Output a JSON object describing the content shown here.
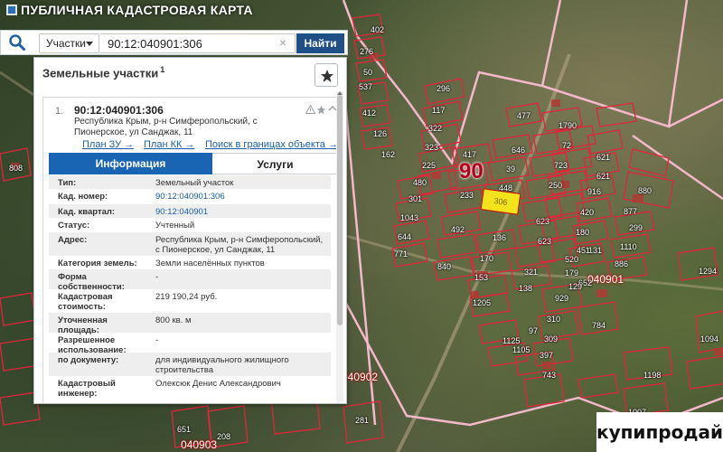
{
  "app": {
    "title": "ПУБЛИЧНАЯ КАДАСТРОВАЯ КАРТА"
  },
  "search": {
    "type_selected": "Участки",
    "value": "90:12:040901:306",
    "clear_symbol": "×",
    "button_label": "Найти"
  },
  "panel": {
    "title": "Земельные участки",
    "title_sup": "1",
    "result": {
      "index": "1.",
      "number": "90:12:040901:306",
      "address": "Республика Крым, р-н Симферопольский, с Пионерское, ул Санджак, 11"
    },
    "links": [
      "План ЗУ →",
      "План КК →",
      "Поиск в границах объекта →"
    ],
    "tabs": [
      "Информация",
      "Услуги"
    ],
    "info": [
      {
        "k": "Тип:",
        "v": "Земельный участок"
      },
      {
        "k": "Кад. номер:",
        "v": "90:12:040901:306",
        "link": true
      },
      {
        "k": "Кад. квартал:",
        "v": "90:12:040901",
        "link": true
      },
      {
        "k": "Статус:",
        "v": "Учтенный"
      },
      {
        "k": "Адрес:",
        "v": "Республика Крым, р-н Симферопольский, с Пионерское, ул Санджак, 11"
      },
      {
        "k": "Категория земель:",
        "v": "Земли населённых пунктов"
      },
      {
        "k": "Форма собственности:",
        "v": "-"
      },
      {
        "k": "Кадастровая стоимость:",
        "v": "219 190,24 руб."
      },
      {
        "k": "Уточненная площадь:",
        "v": "800 кв. м"
      },
      {
        "k": "Разрешенное использование:",
        "v": "-"
      },
      {
        "k": "по документу:",
        "v": "для индивидуального жилищного строительства"
      },
      {
        "k": "Кадастровый инженер:",
        "v": "Олексюк Денис Александрович"
      }
    ]
  },
  "map": {
    "block_label": "90",
    "selected_parcel": "306",
    "quarter_labels": [
      "040901",
      "040902",
      "040903"
    ],
    "parcel_labels": [
      "296",
      "117",
      "322",
      "323",
      "225",
      "480",
      "301",
      "1043",
      "644",
      "771",
      "417",
      "646",
      "39",
      "448",
      "233",
      "492",
      "170",
      "840",
      "153",
      "1205",
      "136",
      "138",
      "97",
      "1125",
      "477",
      "1790",
      "72",
      "621",
      "723",
      "250",
      "916",
      "623",
      "321",
      "179",
      "929",
      "310",
      "309",
      "397",
      "1105",
      "743",
      "880",
      "877",
      "299",
      "1110",
      "886",
      "652",
      "784",
      "1198",
      "1094",
      "1007",
      "281",
      "651",
      "208",
      "808",
      "402",
      "276",
      "50",
      "537",
      "412",
      "126",
      "162",
      "1294",
      "621",
      "623",
      "420",
      "180",
      "131",
      "451",
      "520",
      "129"
    ]
  },
  "watermark": "купипродай"
}
